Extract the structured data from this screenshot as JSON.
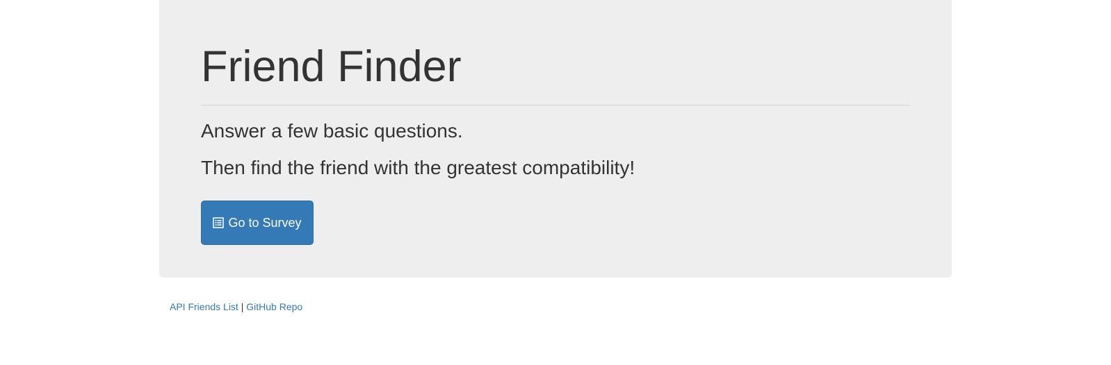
{
  "jumbotron": {
    "title": "Friend Finder",
    "lead_line_1": "Answer a few basic questions.",
    "lead_line_2": "Then find the friend with the greatest compatibility!",
    "survey_button": {
      "label": "Go to Survey",
      "icon": "list-alt-icon"
    }
  },
  "footer": {
    "api_link_label": "API Friends List",
    "separator": "|",
    "github_link_label": "GitHub Repo"
  },
  "colors": {
    "jumbotron_bg": "#eeeeee",
    "primary_button": "#337ab7",
    "link": "#337ab7",
    "text": "#333333"
  }
}
